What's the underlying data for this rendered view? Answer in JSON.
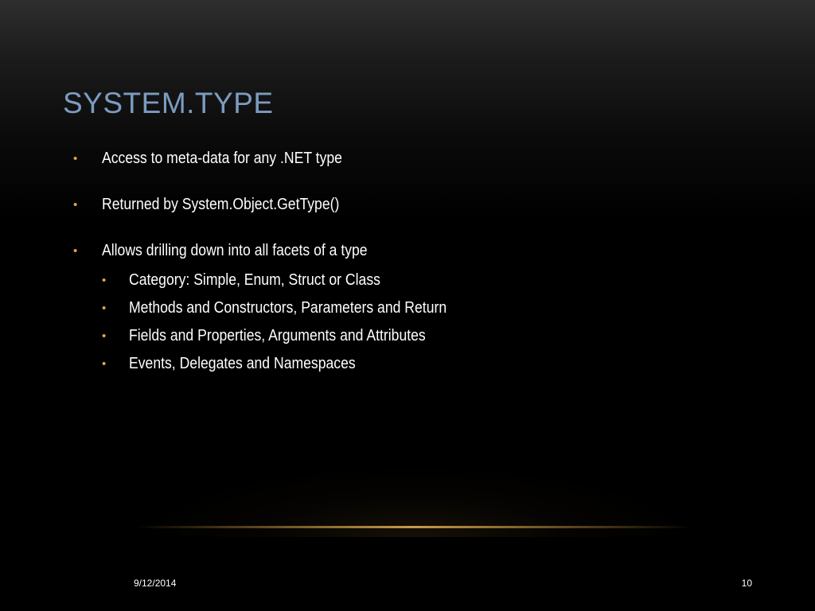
{
  "slide": {
    "title": "SYSTEM.TYPE",
    "bullet_symbol": "•",
    "bullets": [
      {
        "text": "Access to meta-data for any .NET type"
      },
      {
        "text": "Returned by System.Object.GetType()"
      },
      {
        "text": "Allows drilling down into all facets of a type",
        "sub_bullets": [
          "Category: Simple, Enum, Struct or Class",
          "Methods and Constructors, Parameters and Return",
          "Fields and Properties, Arguments and Attributes",
          "Events, Delegates and Namespaces"
        ]
      }
    ],
    "footer": {
      "date": "9/12/2014",
      "page_number": "10"
    },
    "colors": {
      "title": "#7b9cc0",
      "bullet": "#e5a44a",
      "body_text": "#ffffff",
      "accent_rule": "#c9994a",
      "background": "#000000"
    }
  }
}
